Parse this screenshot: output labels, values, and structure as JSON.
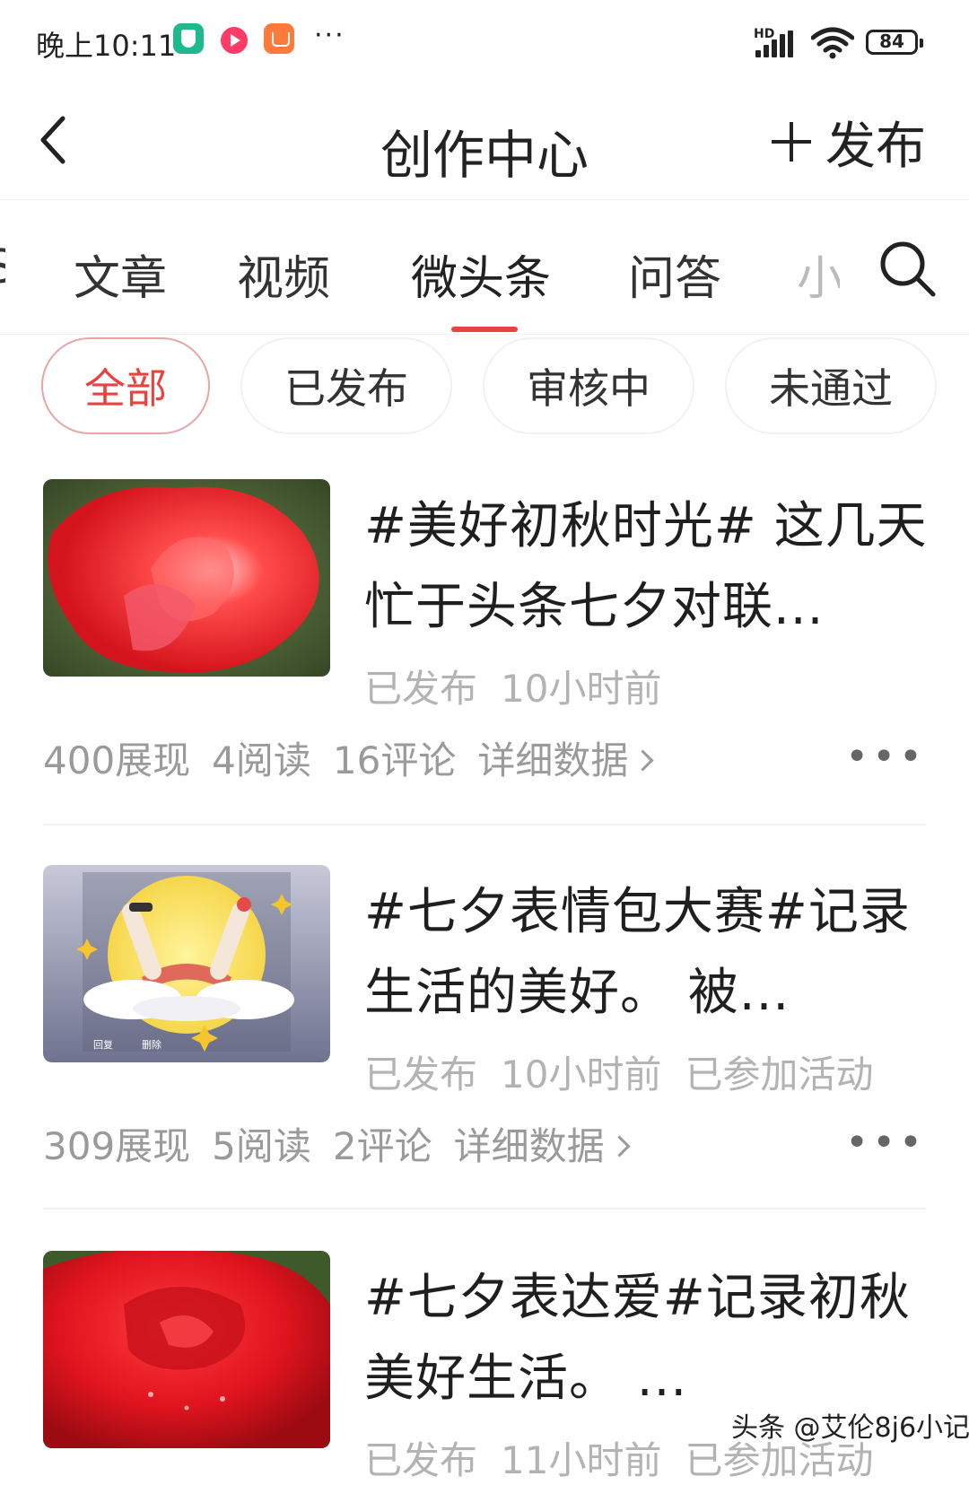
{
  "status_bar": {
    "time": "晚上10:11",
    "more": "···",
    "hd": "HD",
    "battery": "84"
  },
  "header": {
    "title": "创作中心",
    "publish_label": "发布"
  },
  "tabs": {
    "partial_left": "S",
    "items": [
      "文章",
      "视频",
      "微头条",
      "问答",
      "小"
    ],
    "active_index": 2,
    "accent_color": "#e8433f"
  },
  "filters": [
    "全部",
    "已发布",
    "审核中",
    "未通过"
  ],
  "posts": [
    {
      "title": "#美好初秋时光# 这几天忙于头条七夕对联...",
      "status": "已发布",
      "time": "10小时前",
      "activity": "",
      "impressions": "400展现",
      "reads": "4阅读",
      "comments": "16评论",
      "detail": "详细数据"
    },
    {
      "title": "#七夕表情包大赛#记录生活的美好。 被...",
      "status": "已发布",
      "time": "10小时前",
      "activity": "已参加活动",
      "impressions": "309展现",
      "reads": "5阅读",
      "comments": "2评论",
      "detail": "详细数据"
    },
    {
      "title": "#七夕表达爱#记录初秋美好生活。 ...",
      "status": "已发布",
      "time": "11小时前",
      "activity": "已参加活动"
    }
  ],
  "thumb_small_text": {
    "reply": "回复",
    "delete": "删除"
  },
  "watermark": "头条 @艾伦8j6小记"
}
